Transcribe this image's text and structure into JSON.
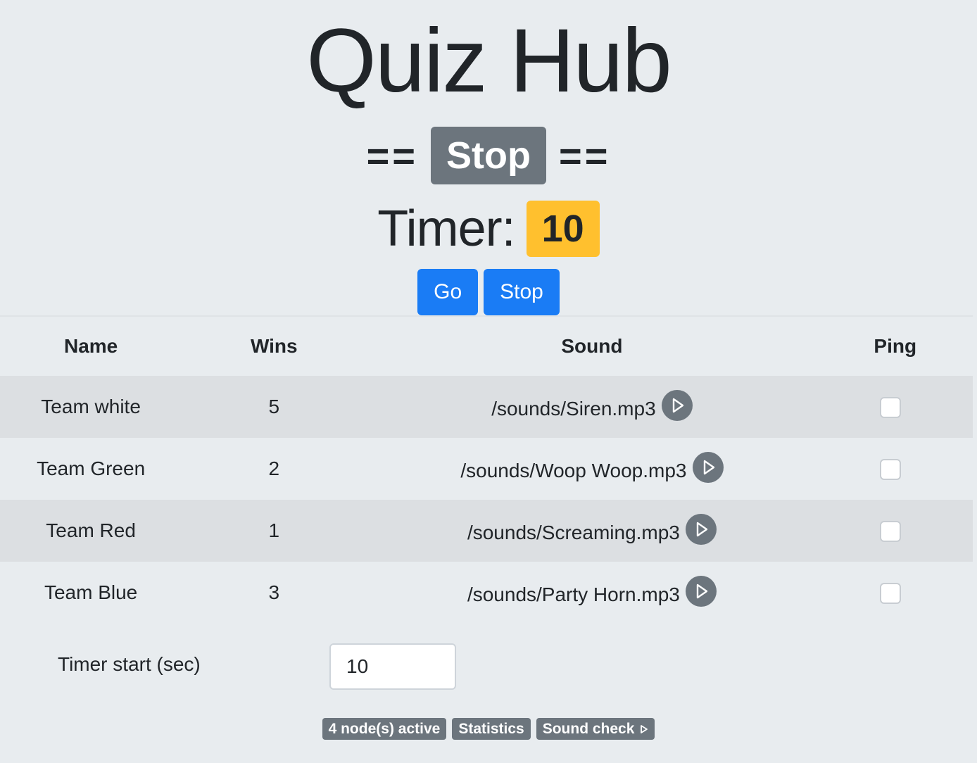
{
  "app": {
    "title": "Quiz Hub"
  },
  "state": {
    "prefix": "==",
    "label": "Stop",
    "suffix": "=="
  },
  "timer": {
    "label": "Timer:",
    "value": "10",
    "badge_color": "#ffc02e"
  },
  "controls": {
    "go_label": "Go",
    "stop_label": "Stop",
    "button_color": "#1a7cf5"
  },
  "table": {
    "headers": [
      "Name",
      "Wins",
      "Sound",
      "Ping"
    ],
    "rows": [
      {
        "name": "Team white",
        "wins": "5",
        "sound": "/sounds/Siren.mp3",
        "ping": false
      },
      {
        "name": "Team Green",
        "wins": "2",
        "sound": "/sounds/Woop Woop.mp3",
        "ping": false
      },
      {
        "name": "Team Red",
        "wins": "1",
        "sound": "/sounds/Screaming.mp3",
        "ping": false
      },
      {
        "name": "Team Blue",
        "wins": "3",
        "sound": "/sounds/Party Horn.mp3",
        "ping": false
      }
    ],
    "play_icon": "play-circle-icon"
  },
  "settings": {
    "timer_start_label": "Timer start (sec)",
    "timer_start_value": "10"
  },
  "footer": {
    "nodes_active": "4 node(s) active",
    "statistics": "Statistics",
    "sound_check": "Sound check",
    "sound_check_icon": "play-triangle-icon"
  }
}
